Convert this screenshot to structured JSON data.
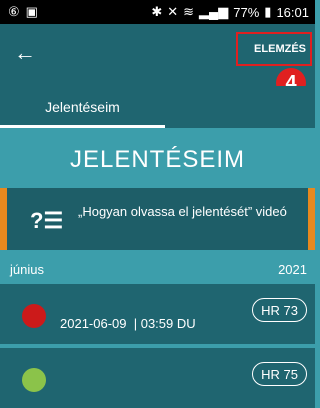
{
  "status_bar": {
    "left_icons": [
      "6-icon",
      "image-icon"
    ],
    "battery": "77%",
    "time": "16:01"
  },
  "app_bar": {
    "back_icon": "arrow-left-icon",
    "analyze_label": "ELEMZÉS",
    "callout_number": "4",
    "callout_color": "#e02020"
  },
  "tabs": [
    {
      "label": "Jelentéseim",
      "active": true
    }
  ],
  "page_title": "JELENTÉSEIM",
  "video_card": {
    "icon": "help-list-icon",
    "text": "„Hogyan olvassa el jelentését” videó",
    "accent_color": "#e8891e"
  },
  "month_section": {
    "month": "június",
    "year": "2021"
  },
  "reports": [
    {
      "date": "2021-06-09",
      "time": "| 03:59 DU",
      "hr": "HR 73",
      "status_color": "#cc1a1a"
    },
    {
      "date": "",
      "time": "",
      "hr": "HR 75",
      "status_color": "#8bc34a"
    }
  ]
}
